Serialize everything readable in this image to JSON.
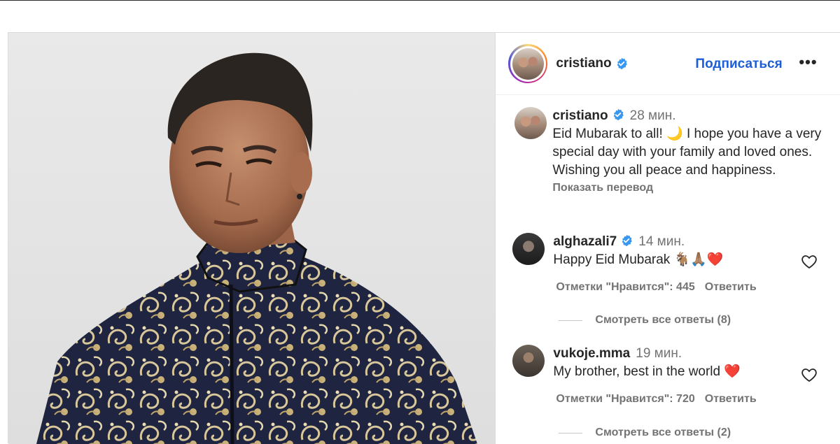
{
  "post": {
    "author": "cristiano",
    "follow_label": "Подписаться",
    "more_label": "•••",
    "caption": {
      "author": "cristiano",
      "time": "28 мин.",
      "text": "Eid Mubarak to all! 🌙 I hope you have a very special day with your family and loved ones. Wishing you all peace and happiness.",
      "translate_label": "Показать перевод"
    },
    "comments": [
      {
        "author": "alghazali7",
        "verified": true,
        "time": "14 мин.",
        "text": "Happy Eid Mubarak 🐐🙏🏽❤️",
        "likes": "Отметки \"Нравится\": 445",
        "reply_label": "Ответить",
        "view_replies": "Смотреть все ответы (8)"
      },
      {
        "author": "vukoje.mma",
        "verified": false,
        "time": "19 мин.",
        "text": "My brother, best in the world ❤️",
        "likes": "Отметки \"Нравится\": 720",
        "reply_label": "Ответить",
        "view_replies": "Смотреть все ответы (2)"
      }
    ]
  },
  "colors": {
    "link": "#1c5ed6",
    "muted": "#737373",
    "verified": "#3897f0",
    "text": "#262626"
  },
  "icons": [
    "verified-badge-icon",
    "heart-icon",
    "more-options-icon"
  ]
}
